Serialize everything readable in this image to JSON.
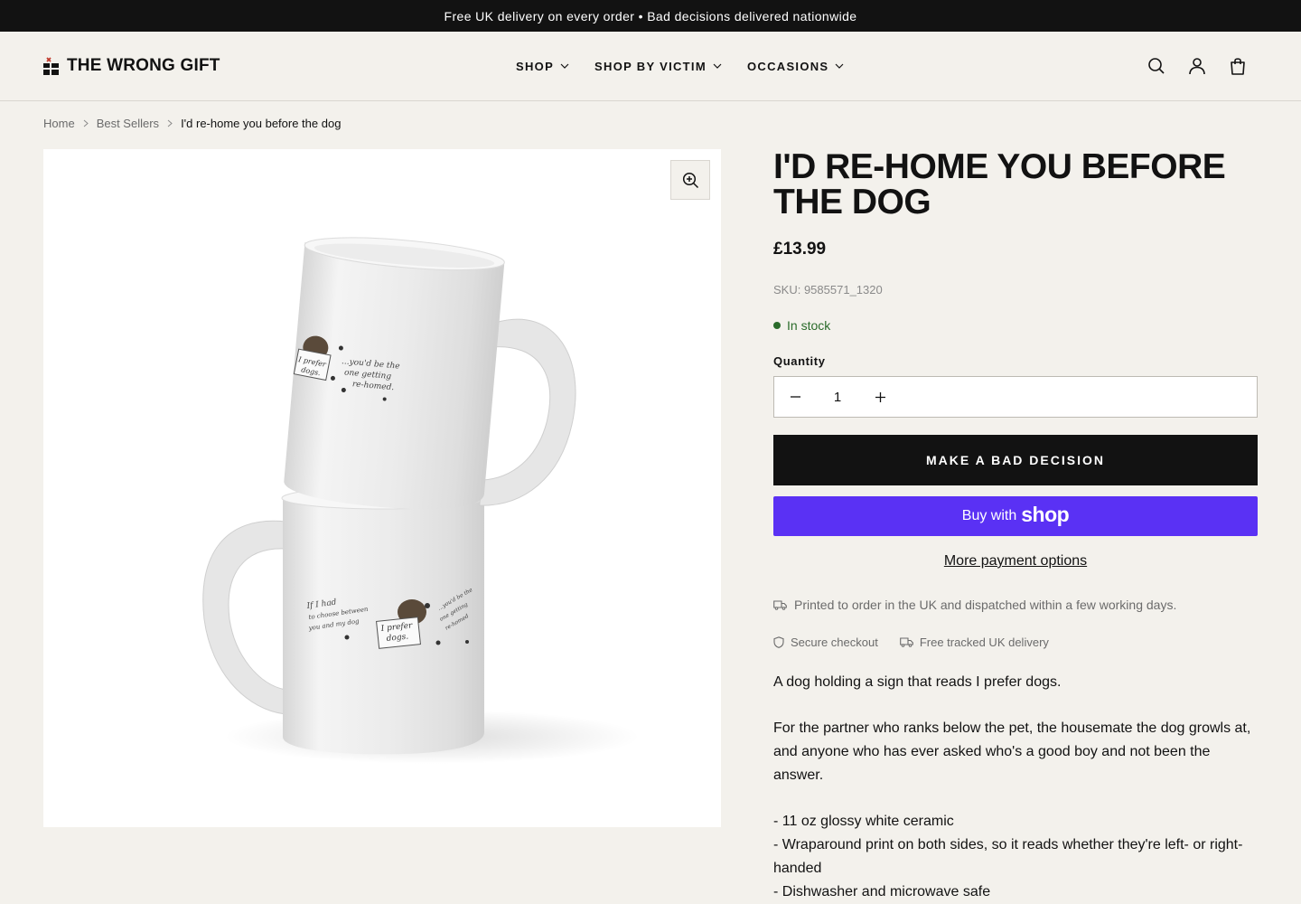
{
  "announcement": "Free UK delivery on every order • Bad decisions delivered nationwide",
  "header": {
    "logo_text": "THE WRONG GIFT",
    "nav": [
      {
        "label": "SHOP"
      },
      {
        "label": "SHOP BY VICTIM"
      },
      {
        "label": "OCCASIONS"
      }
    ],
    "icons": [
      "search-icon",
      "account-icon",
      "cart-icon"
    ]
  },
  "breadcrumb": {
    "home": "Home",
    "category": "Best Sellers",
    "current": "I'd re-home you before the dog"
  },
  "product": {
    "title": "I'D RE-HOME YOU BEFORE THE DOG",
    "price": "£13.99",
    "sku": "SKU: 9585571_1320",
    "stock": "In stock",
    "quantity_label": "Quantity",
    "quantity": "1",
    "add_to_cart": "MAKE A BAD DECISION",
    "buy_with": "Buy with",
    "shop_brand": "shop",
    "more_payment": "More payment options",
    "dispatch_note": "Printed to order in the UK and dispatched within a few working days.",
    "badges": {
      "secure": "Secure checkout",
      "delivery": "Free tracked UK delivery"
    },
    "description": {
      "intro": "A dog holding a sign that reads I prefer dogs.",
      "body": "For the partner who ranks below the pet, the housemate the dog growls at, and anyone who has ever asked who's a good boy and not been the answer.",
      "features": [
        "- 11 oz glossy white ceramic",
        "- Wraparound print on both sides, so it reads whether they're left- or right-handed",
        "- Dishwasher and microwave safe"
      ]
    }
  },
  "image_print": {
    "top_mug": {
      "sign": [
        "I prefer",
        "dogs."
      ],
      "text": [
        "...you'd be the",
        "one getting",
        "re-homed."
      ]
    },
    "bottom_mug": {
      "left_text": [
        "If I had",
        "to choose between",
        "you and my dog"
      ],
      "sign": [
        "I prefer",
        "dogs."
      ],
      "right_text": [
        "...you'd be the",
        "one getting",
        "re-homed"
      ]
    }
  },
  "colors": {
    "background": "#f3f1ec",
    "announcement_bg": "#121212",
    "primary_button": "#121212",
    "shop_pay": "#5a31f4",
    "in_stock": "#2a6b2a"
  }
}
